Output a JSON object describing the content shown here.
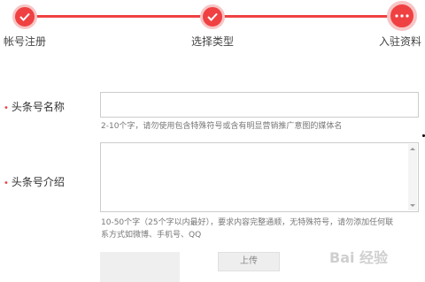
{
  "steps": [
    {
      "label": "帐号注册",
      "state": "done"
    },
    {
      "label": "选择类型",
      "state": "done"
    },
    {
      "label": "入驻资料",
      "state": "current"
    }
  ],
  "accent_color": "#f04142",
  "form": {
    "name_field": {
      "label": "头条号名称",
      "value": "",
      "hint": "2-10个字，请勿使用包含特殊符号或含有明显营销推广意图的媒体名"
    },
    "intro_field": {
      "label": "头条号介绍",
      "value": "",
      "hint_line1": "10-50个字（25个字以内最好），要求内容完整通顺，无特殊符号，请勿添加任何联",
      "hint_line2": "系方式如微博、手机号、QQ"
    },
    "upload_button": "上传"
  },
  "watermark": "Bai 经验"
}
